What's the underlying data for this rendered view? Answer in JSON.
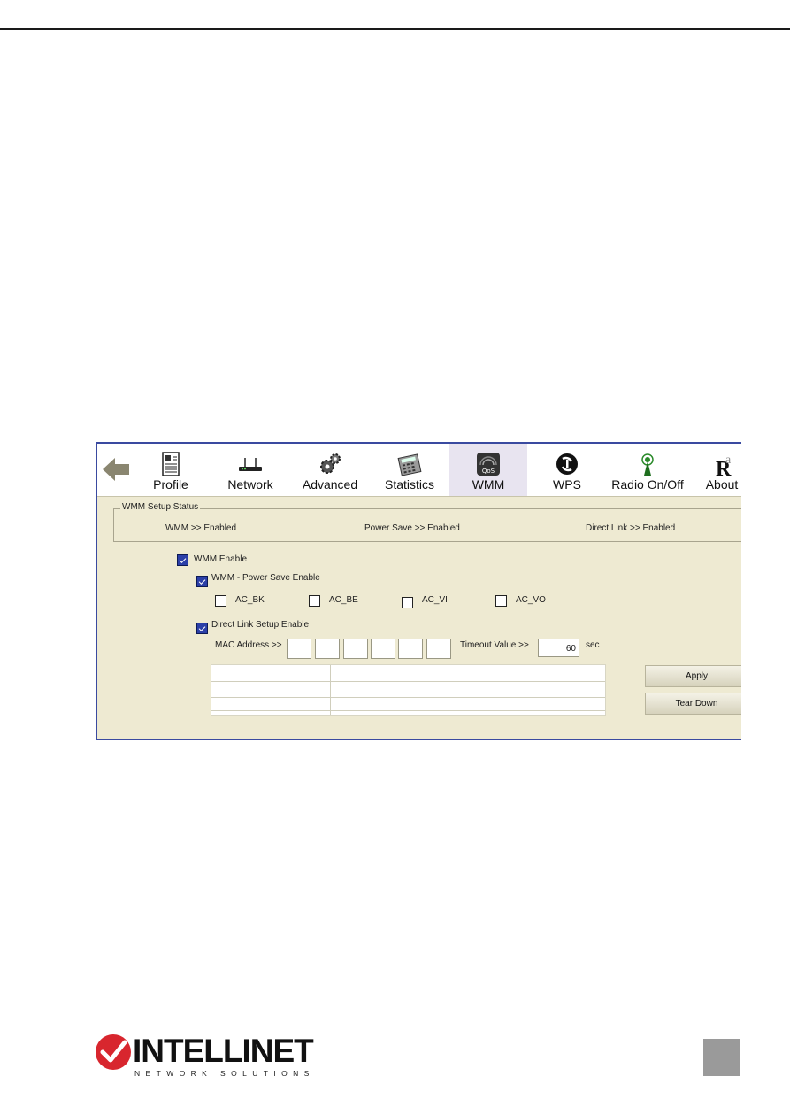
{
  "toolbar": {
    "items": [
      {
        "label": "Profile",
        "icon": "profile-icon"
      },
      {
        "label": "Network",
        "icon": "router-icon"
      },
      {
        "label": "Advanced",
        "icon": "gears-icon"
      },
      {
        "label": "Statistics",
        "icon": "calculator-icon"
      },
      {
        "label": "WMM",
        "icon": "qos-icon"
      },
      {
        "label": "WPS",
        "icon": "wps-icon"
      },
      {
        "label": "Radio On/Off",
        "icon": "antenna-icon"
      },
      {
        "label": "About",
        "icon": "ralink-icon"
      }
    ],
    "active": "WMM"
  },
  "status": {
    "title": "WMM Setup Status",
    "wmm": "WMM >> Enabled",
    "power_save": "Power Save >> Enabled",
    "direct_link": "Direct Link >> Enabled"
  },
  "options": {
    "wmm_enable": "WMM Enable",
    "power_save_enable": "WMM - Power Save Enable",
    "ac_bk": "AC_BK",
    "ac_be": "AC_BE",
    "ac_vi": "AC_VI",
    "ac_vo": "AC_VO",
    "direct_link_enable": "Direct Link Setup Enable"
  },
  "direct_link": {
    "mac_label": "MAC Address >>",
    "timeout_label": "Timeout Value >>",
    "timeout_value": "60",
    "timeout_unit": "sec"
  },
  "buttons": {
    "apply": "Apply",
    "tear_down": "Tear Down"
  },
  "footer": {
    "brand": "INTELLINET",
    "tagline": "NETWORK SOLUTIONS"
  },
  "colors": {
    "panel": "#eeead2",
    "checked": "#2b3fa8",
    "window_border": "#3a4aa0",
    "logo_red": "#d8262e"
  }
}
